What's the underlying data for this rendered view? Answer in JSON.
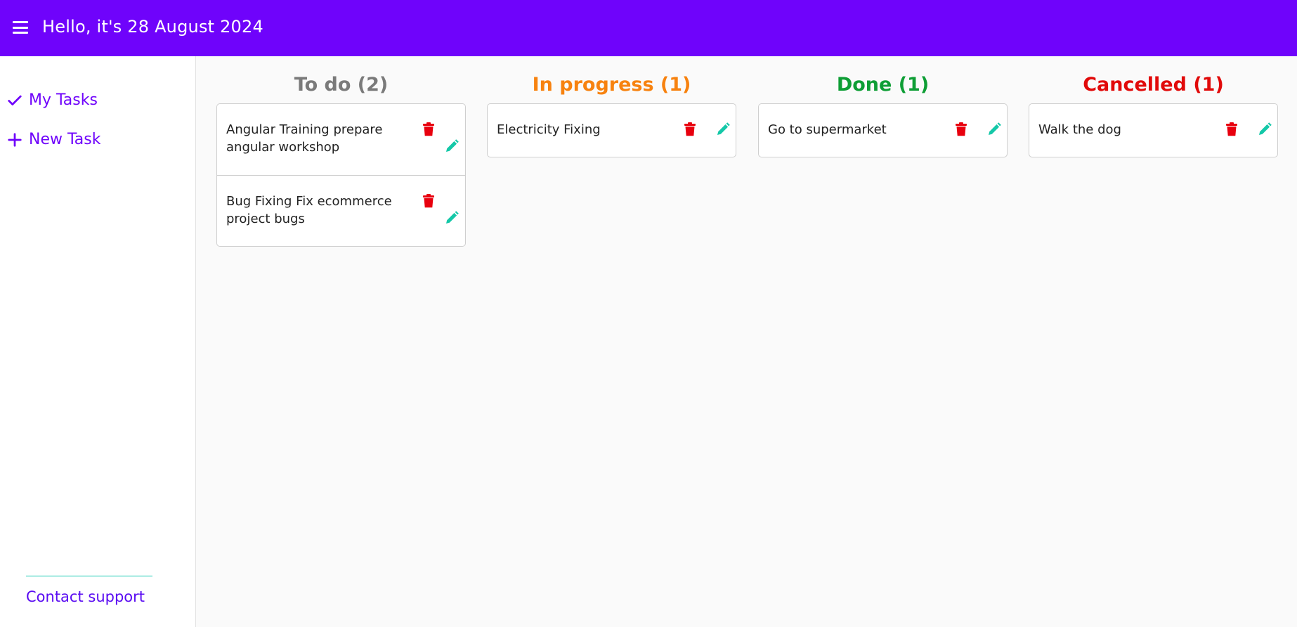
{
  "header": {
    "menu_icon": "hamburger-menu-icon",
    "title": "Hello, it's 28 August 2024",
    "color": "#6f03fb"
  },
  "sidebar": {
    "items": [
      {
        "label": "My Tasks",
        "icon": "check-icon"
      },
      {
        "label": "New Task",
        "icon": "plus-icon"
      }
    ],
    "footer_link": "Contact support"
  },
  "board": {
    "columns": [
      {
        "title": "To do (2)",
        "color": "#7a7a7a",
        "tasks": [
          {
            "text": "Angular Training prepare angular workshop"
          },
          {
            "text": "Bug Fixing Fix ecommerce project bugs"
          }
        ]
      },
      {
        "title": "In progress (1)",
        "color": "#f7820f",
        "tasks": [
          {
            "text": "Electricity Fixing"
          }
        ]
      },
      {
        "title": "Done (1)",
        "color": "#0e9e35",
        "tasks": [
          {
            "text": "Go to supermarket"
          }
        ]
      },
      {
        "title": "Cancelled (1)",
        "color": "#e10a0a",
        "tasks": [
          {
            "text": "Walk the dog"
          }
        ]
      }
    ],
    "task_actions": {
      "delete_icon": "trash-icon",
      "edit_icon": "pencil-icon",
      "delete_color": "#e8000e",
      "edit_color": "#14c8a8"
    }
  }
}
